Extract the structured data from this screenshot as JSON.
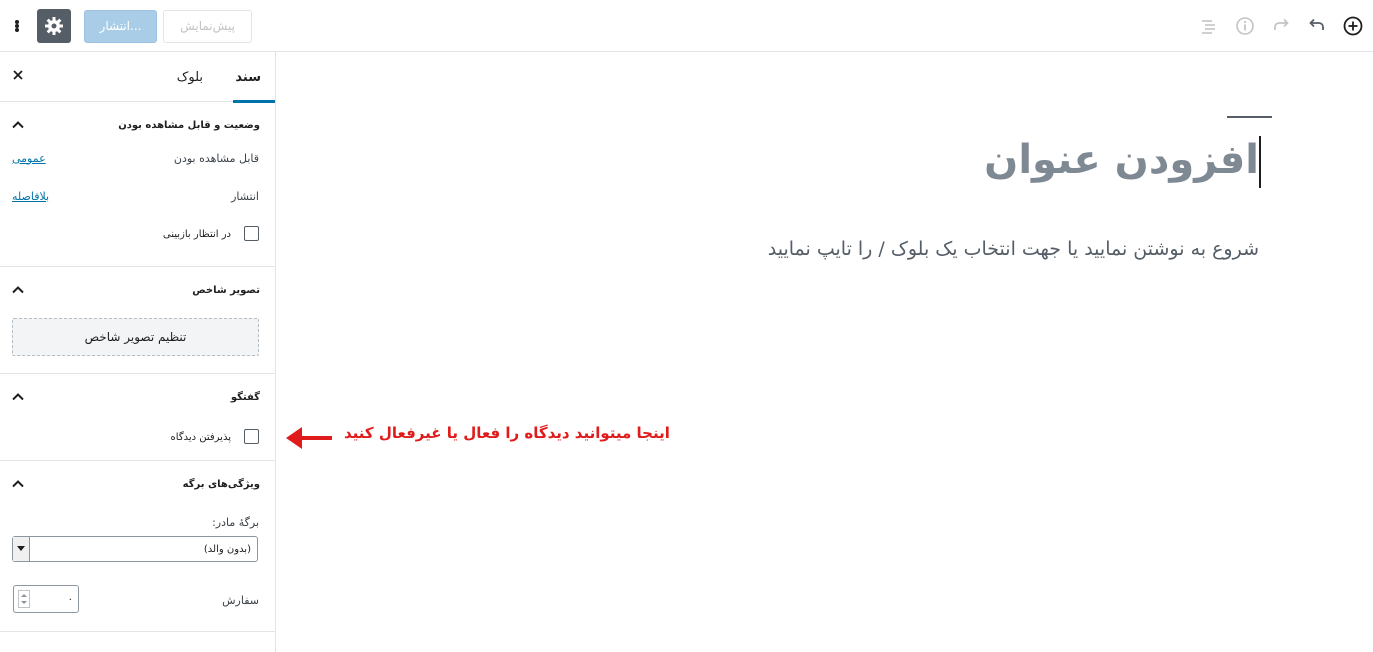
{
  "toolbar": {
    "publish_label": "انتشار...",
    "preview_label": "پیش‌نمایش",
    "icons": [
      "more-icon",
      "gear-icon",
      "add-block-icon",
      "undo-icon",
      "redo-icon",
      "info-icon",
      "outline-icon"
    ]
  },
  "sidebar": {
    "tabs": {
      "document": "سند",
      "block": "بلوک"
    },
    "status_panel": {
      "title": "وضعیت و قابل مشاهده بودن",
      "visibility_label": "قابل مشاهده بودن",
      "visibility_value": "عمومی",
      "publish_label": "انتشار",
      "publish_value": "بلافاصله",
      "pending_review_label": "در انتظار بازبینی"
    },
    "featured_panel": {
      "title": "تصویر شاخص",
      "set_button": "تنظیم تصویر شاخص"
    },
    "discussion_panel": {
      "title": "گفتگو",
      "allow_comments_label": "پذیرفتن دیدگاه"
    },
    "page_attributes_panel": {
      "title": "ویژگی‌های برگه",
      "parent_label": "برگهٔ مادر:",
      "parent_value": "(بدون والد)",
      "order_label": "سفارش",
      "order_value": "۰"
    }
  },
  "editor": {
    "title_placeholder": "افزودن عنوان",
    "body_placeholder": "شروع به نوشتن نمایید یا جهت انتخاب یک بلوک / را تایپ نمایید"
  },
  "annotation": {
    "text": "اینجا میتوانید دیدگاه را فعال یا غیرفعال کنید",
    "color": "#e01b1b"
  },
  "colors": {
    "accent": "#0073aa",
    "publish_disabled": "#a9cde6",
    "settings_button": "#555d66"
  }
}
